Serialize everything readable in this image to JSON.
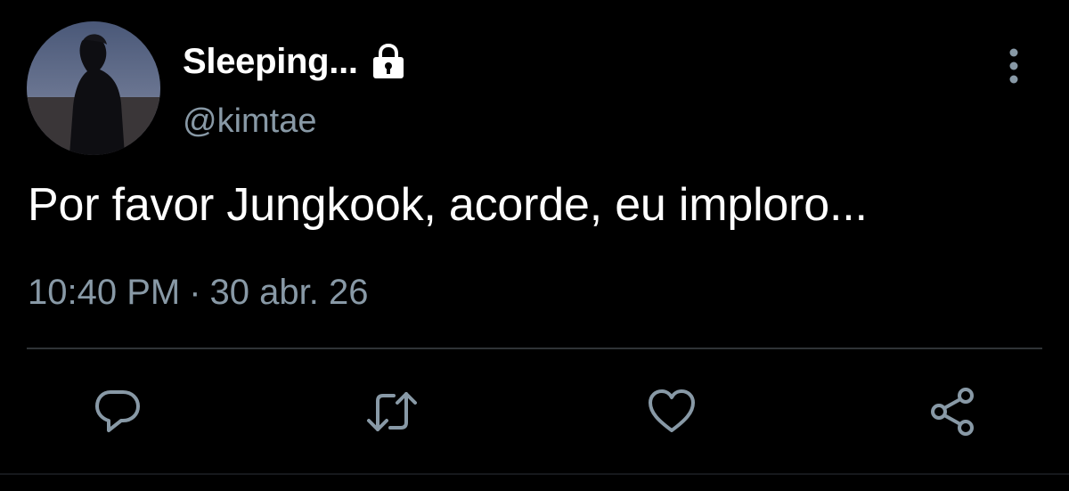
{
  "profile": {
    "display_name": "Sleeping...",
    "handle": "@kimtae",
    "avatar_icon": "profile-photo",
    "locked_icon": "lock-icon"
  },
  "tweet": {
    "text": "Por favor Jungkook, acorde, eu imploro...",
    "time": "10:40 PM",
    "separator": "·",
    "date": "30 abr. 26"
  },
  "actions": {
    "reply_icon": "reply-icon",
    "retweet_icon": "retweet-icon",
    "like_icon": "heart-icon",
    "share_icon": "share-icon"
  },
  "menu": {
    "icon": "more-vertical-icon"
  },
  "colors": {
    "background": "#000000",
    "primary_text": "#ffffff",
    "secondary_text": "#8899a6",
    "divider": "#2f3336"
  }
}
